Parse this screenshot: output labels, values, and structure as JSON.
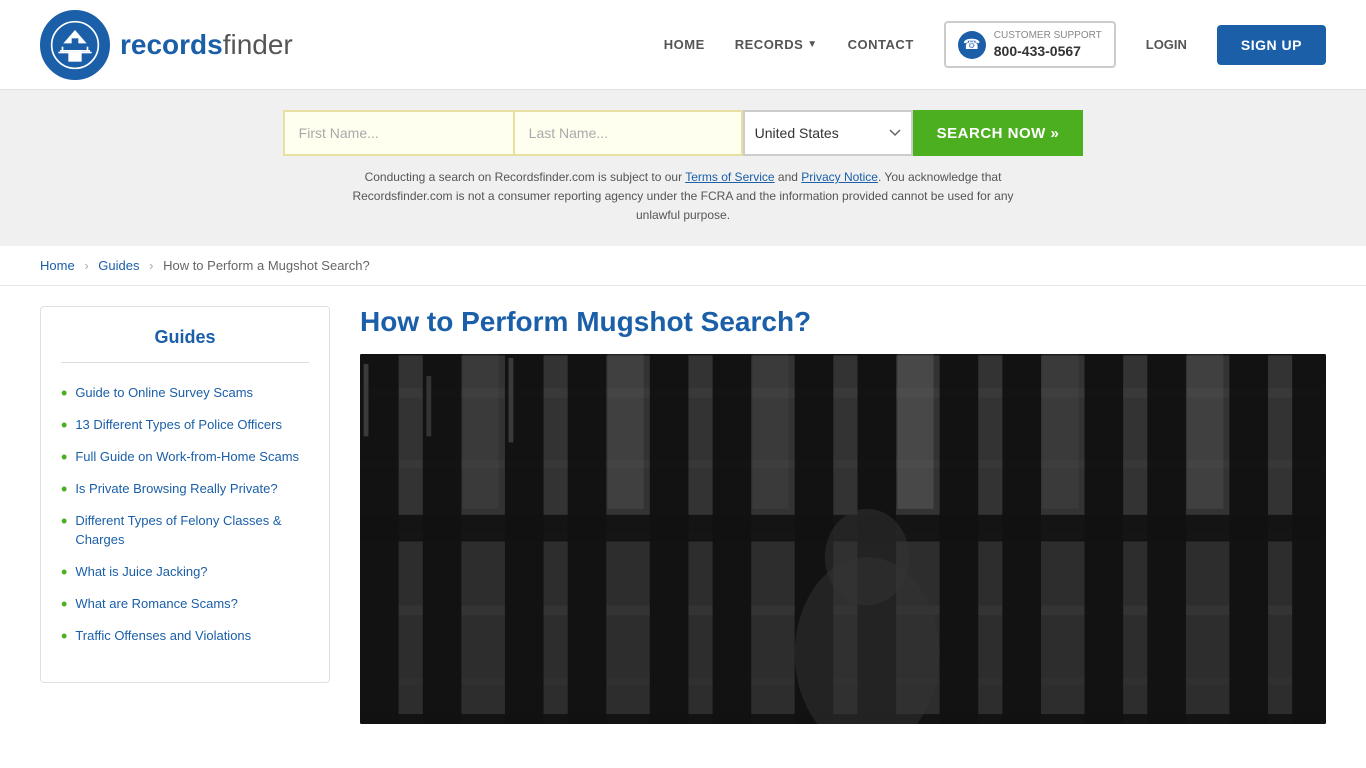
{
  "header": {
    "logo_text_records": "records",
    "logo_text_finder": "finder",
    "nav_home": "HOME",
    "nav_records": "RECORDS",
    "nav_contact": "CONTACT",
    "support_label": "CUSTOMER SUPPORT",
    "support_number": "800-433-0567",
    "login_label": "LOGIN",
    "signup_label": "SIGN UP"
  },
  "search": {
    "first_name_placeholder": "First Name...",
    "last_name_placeholder": "Last Name...",
    "state_value": "United States",
    "search_button": "SEARCH NOW »",
    "disclaimer": "Conducting a search on Recordsfinder.com is subject to our Terms of Service and Privacy Notice. You acknowledge that Recordsfinder.com is not a consumer reporting agency under the FCRA and the information provided cannot be used for any unlawful purpose.",
    "terms_label": "Terms of Service",
    "privacy_label": "Privacy Notice"
  },
  "breadcrumb": {
    "home": "Home",
    "guides": "Guides",
    "current": "How to Perform a Mugshot Search?"
  },
  "sidebar": {
    "title": "Guides",
    "items": [
      {
        "label": "Guide to Online Survey Scams"
      },
      {
        "label": "13 Different Types of Police Officers"
      },
      {
        "label": "Full Guide on Work-from-Home Scams"
      },
      {
        "label": "Is Private Browsing Really Private?"
      },
      {
        "label": "Different Types of Felony Classes & Charges"
      },
      {
        "label": "What is Juice Jacking?"
      },
      {
        "label": "What are Romance Scams?"
      },
      {
        "label": "Traffic Offenses and Violations"
      }
    ]
  },
  "article": {
    "title": "How to Perform Mugshot Search?"
  }
}
